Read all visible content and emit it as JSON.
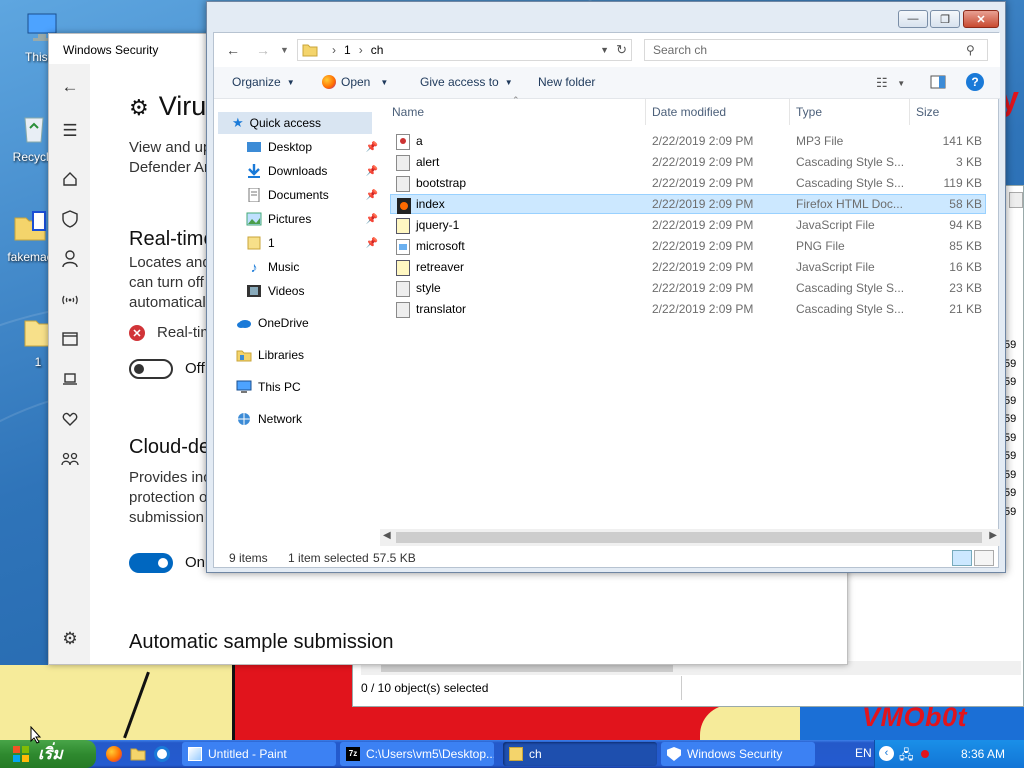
{
  "desktop": {
    "icons": [
      {
        "label": "This P",
        "name": "this-pc"
      },
      {
        "label": "Recycle",
        "name": "recycle-bin"
      },
      {
        "label": "fakemac",
        "name": "fakemac-folder"
      },
      {
        "label": "1",
        "name": "folder-1"
      }
    ],
    "wallpaper_text": "VMOb0t"
  },
  "back_window": {
    "status": "0 / 10 object(s) selected",
    "side_values": [
      "59",
      "59",
      "59",
      "59",
      "59",
      "59",
      "59",
      "59",
      "59",
      "59"
    ]
  },
  "security": {
    "window_title": "Windows Security",
    "heading": "Viru",
    "intro_line1": "View and up",
    "intro_line2": "Defender An",
    "realtime_title": "Real-time",
    "realtime_line1": "Locates and",
    "realtime_line2": "can turn off",
    "realtime_line3": "automaticall",
    "realtime_status": "Real-tim",
    "realtime_toggle": "Off",
    "cloud_title": "Cloud-de",
    "cloud_line1": "Provides inc",
    "cloud_line2": "protection o",
    "cloud_line3": "submission",
    "cloud_toggle": "On",
    "auto_title": "Automatic sample submission",
    "rail_icons": [
      "back-arrow-icon",
      "hamburger-menu-icon",
      "home-icon",
      "shield-icon",
      "account-icon",
      "wifi-icon",
      "app-browser-icon",
      "laptop-icon",
      "heart-icon",
      "family-icon",
      "settings-gear-icon"
    ]
  },
  "explorer": {
    "breadcrumb": [
      "1",
      "ch"
    ],
    "search_placeholder": "Search ch",
    "toolbar": {
      "organize": "Organize",
      "open": "Open",
      "give_access": "Give access to",
      "new_folder": "New folder"
    },
    "nav": {
      "quick_access": "Quick access",
      "items": [
        {
          "label": "Desktop",
          "pinned": true
        },
        {
          "label": "Downloads",
          "pinned": true
        },
        {
          "label": "Documents",
          "pinned": true
        },
        {
          "label": "Pictures",
          "pinned": true
        },
        {
          "label": "1",
          "pinned": true
        },
        {
          "label": "Music",
          "pinned": false
        },
        {
          "label": "Videos",
          "pinned": false
        }
      ],
      "onedrive": "OneDrive",
      "libraries": "Libraries",
      "this_pc": "This PC",
      "network": "Network"
    },
    "columns": [
      "Name",
      "Date modified",
      "Type",
      "Size"
    ],
    "files": [
      {
        "name": "a",
        "date": "2/22/2019 2:09 PM",
        "type": "MP3 File",
        "size": "141 KB"
      },
      {
        "name": "alert",
        "date": "2/22/2019 2:09 PM",
        "type": "Cascading Style S...",
        "size": "3 KB"
      },
      {
        "name": "bootstrap",
        "date": "2/22/2019 2:09 PM",
        "type": "Cascading Style S...",
        "size": "119 KB"
      },
      {
        "name": "index",
        "date": "2/22/2019 2:09 PM",
        "type": "Firefox HTML Doc...",
        "size": "58 KB"
      },
      {
        "name": "jquery-1",
        "date": "2/22/2019 2:09 PM",
        "type": "JavaScript File",
        "size": "94 KB"
      },
      {
        "name": "microsoft",
        "date": "2/22/2019 2:09 PM",
        "type": "PNG File",
        "size": "85 KB"
      },
      {
        "name": "retreaver",
        "date": "2/22/2019 2:09 PM",
        "type": "JavaScript File",
        "size": "16 KB"
      },
      {
        "name": "style",
        "date": "2/22/2019 2:09 PM",
        "type": "Cascading Style S...",
        "size": "23 KB"
      },
      {
        "name": "translator",
        "date": "2/22/2019 2:09 PM",
        "type": "Cascading Style S...",
        "size": "21 KB"
      }
    ],
    "selected_file": "index",
    "status": {
      "count": "9 items",
      "selected": "1 item selected",
      "size": "57.5 KB"
    }
  },
  "taskbar": {
    "start_label": "เริ่ม",
    "buttons": [
      {
        "label": "Untitled - Paint",
        "name": "paint"
      },
      {
        "label": "C:\\Users\\vm5\\Desktop...",
        "name": "7zip"
      },
      {
        "label": "ch",
        "name": "explorer-ch"
      },
      {
        "label": "Windows Security",
        "name": "windows-security"
      }
    ],
    "language": "EN",
    "clock": "8:36 AM"
  },
  "colors": {
    "accent": "#0067c0",
    "selection": "#cce8ff",
    "taskbar": "#245bd0",
    "start": "#2f8a2f",
    "error_red": "#d13438"
  }
}
